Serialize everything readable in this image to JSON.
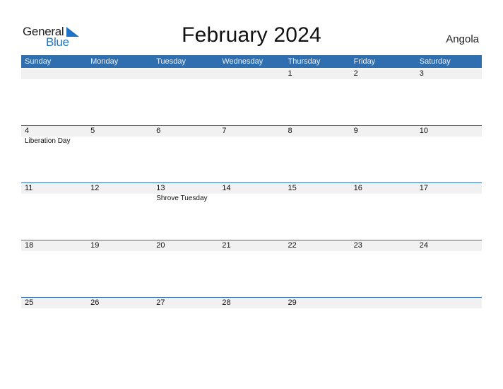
{
  "logo": {
    "part1": "General",
    "part2": "Blue"
  },
  "title": "February 2024",
  "country": "Angola",
  "colors": {
    "accent": "#2f6fb0",
    "band": "#f1f1f1",
    "logo_blue": "#1f73c4"
  },
  "weekdays": [
    "Sunday",
    "Monday",
    "Tuesday",
    "Wednesday",
    "Thursday",
    "Friday",
    "Saturday"
  ],
  "weeks": [
    {
      "days": [
        {
          "num": "",
          "event": ""
        },
        {
          "num": "",
          "event": ""
        },
        {
          "num": "",
          "event": ""
        },
        {
          "num": "",
          "event": ""
        },
        {
          "num": "1",
          "event": ""
        },
        {
          "num": "2",
          "event": ""
        },
        {
          "num": "3",
          "event": ""
        }
      ]
    },
    {
      "days": [
        {
          "num": "4",
          "event": "Liberation Day"
        },
        {
          "num": "5",
          "event": ""
        },
        {
          "num": "6",
          "event": ""
        },
        {
          "num": "7",
          "event": ""
        },
        {
          "num": "8",
          "event": ""
        },
        {
          "num": "9",
          "event": ""
        },
        {
          "num": "10",
          "event": ""
        }
      ]
    },
    {
      "days": [
        {
          "num": "11",
          "event": ""
        },
        {
          "num": "12",
          "event": ""
        },
        {
          "num": "13",
          "event": "Shrove Tuesday"
        },
        {
          "num": "14",
          "event": ""
        },
        {
          "num": "15",
          "event": ""
        },
        {
          "num": "16",
          "event": ""
        },
        {
          "num": "17",
          "event": ""
        }
      ]
    },
    {
      "days": [
        {
          "num": "18",
          "event": ""
        },
        {
          "num": "19",
          "event": ""
        },
        {
          "num": "20",
          "event": ""
        },
        {
          "num": "21",
          "event": ""
        },
        {
          "num": "22",
          "event": ""
        },
        {
          "num": "23",
          "event": ""
        },
        {
          "num": "24",
          "event": ""
        }
      ]
    },
    {
      "days": [
        {
          "num": "25",
          "event": ""
        },
        {
          "num": "26",
          "event": ""
        },
        {
          "num": "27",
          "event": ""
        },
        {
          "num": "28",
          "event": ""
        },
        {
          "num": "29",
          "event": ""
        },
        {
          "num": "",
          "event": ""
        },
        {
          "num": "",
          "event": ""
        }
      ]
    }
  ]
}
